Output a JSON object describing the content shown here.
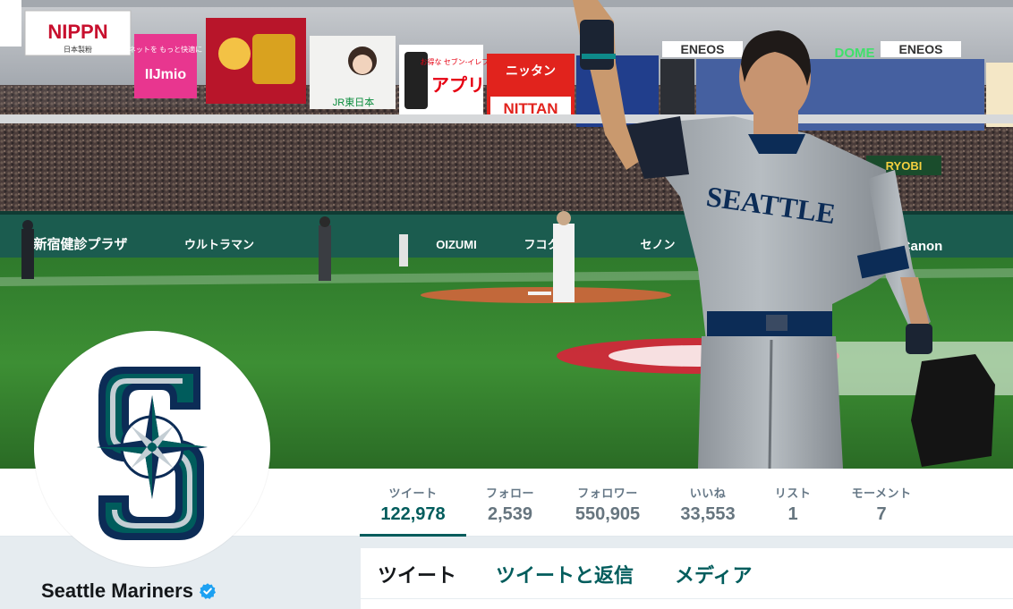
{
  "profile": {
    "name": "Seattle Mariners",
    "verified": true
  },
  "stats": [
    {
      "label": "ツイート",
      "value": "122,978",
      "active": true
    },
    {
      "label": "フォロー",
      "value": "2,539",
      "active": false
    },
    {
      "label": "フォロワー",
      "value": "550,905",
      "active": false
    },
    {
      "label": "いいね",
      "value": "33,553",
      "active": false
    },
    {
      "label": "リスト",
      "value": "1",
      "active": false
    },
    {
      "label": "モーメント",
      "value": "7",
      "active": false
    }
  ],
  "tabs": [
    {
      "label": "ツイート",
      "current": true
    },
    {
      "label": "ツイートと返信",
      "current": false
    },
    {
      "label": "メディア",
      "current": false
    }
  ],
  "banner": {
    "signs": {
      "nippn": "NIPPN",
      "nippn_sub": "日本製粉",
      "iijmio_top": "ネットを もっと快適に",
      "iijmio": "IIJmio",
      "jr": "JR東日本",
      "app": "アプリ",
      "app_top": "お得な セブン-イレブン",
      "nittan_top": "ニッタン",
      "nittan": "NITTAN",
      "eneos": "ENEOS",
      "dome": "DOME",
      "ryobi": "RYOBI",
      "wall_left": "新宿健診プラザ",
      "wall_ultra": "ウルトラマン",
      "wall_oizumi": "OIZUMI",
      "wall_fuko": "フコク",
      "wall_senon": "セノン",
      "wall_canon": "Canon",
      "jersey": "SEATTLE"
    }
  },
  "colors": {
    "accent": "#005c5c",
    "navy": "#0c2c56",
    "verified": "#1da1f2"
  },
  "icons": {
    "verified": "verified-badge-icon",
    "logo": "mariners-s-compass-logo"
  }
}
